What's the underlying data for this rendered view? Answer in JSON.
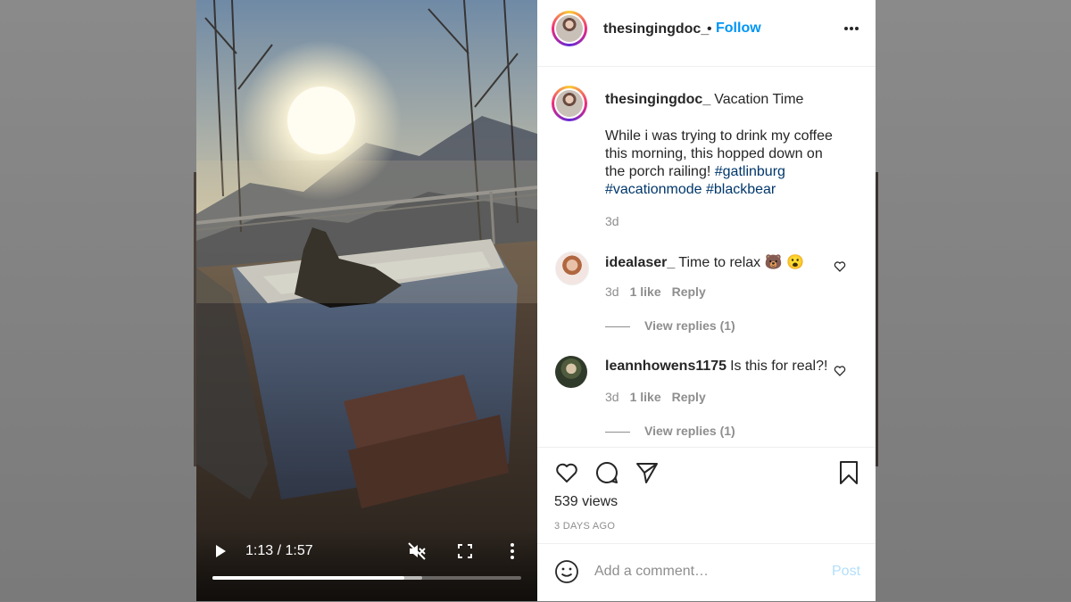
{
  "video": {
    "time_readout": "1:13 / 1:57",
    "progress_fraction": 0.62,
    "buffer_fraction": 0.68,
    "controls": [
      "play-icon",
      "mute-off-icon",
      "fullscreen-icon",
      "more-vert-icon"
    ]
  },
  "header": {
    "username": "thesingingdoc_",
    "separator": "•",
    "follow_label": "Follow"
  },
  "caption": {
    "username": "thesingingdoc_",
    "title": "Vacation Time",
    "text": "While i was trying to drink my coffee this morning, this hopped down on the porch railing!",
    "hashtags": [
      "#gatlinburg",
      "#vacationmode",
      "#blackbear"
    ],
    "time": "3d"
  },
  "comments": [
    {
      "username": "idealaser_",
      "text": "Time to relax 🐻 😮",
      "time": "3d",
      "likes": "1 like",
      "reply_label": "Reply",
      "view_replies": "View replies (1)"
    },
    {
      "username": "leannhowens1175",
      "text": "Is this for real?!",
      "time": "3d",
      "likes": "1 like",
      "reply_label": "Reply",
      "view_replies": "View replies (1)"
    }
  ],
  "stats": {
    "views": "539 views",
    "date": "3 DAYS AGO"
  },
  "comment_box": {
    "placeholder": "Add a comment…",
    "post_label": "Post"
  },
  "colors": {
    "link_blue": "#0095f6",
    "hashtag_blue": "#00376b",
    "muted_gray": "#8e8e8e",
    "post_disabled": "#b2dffc"
  }
}
